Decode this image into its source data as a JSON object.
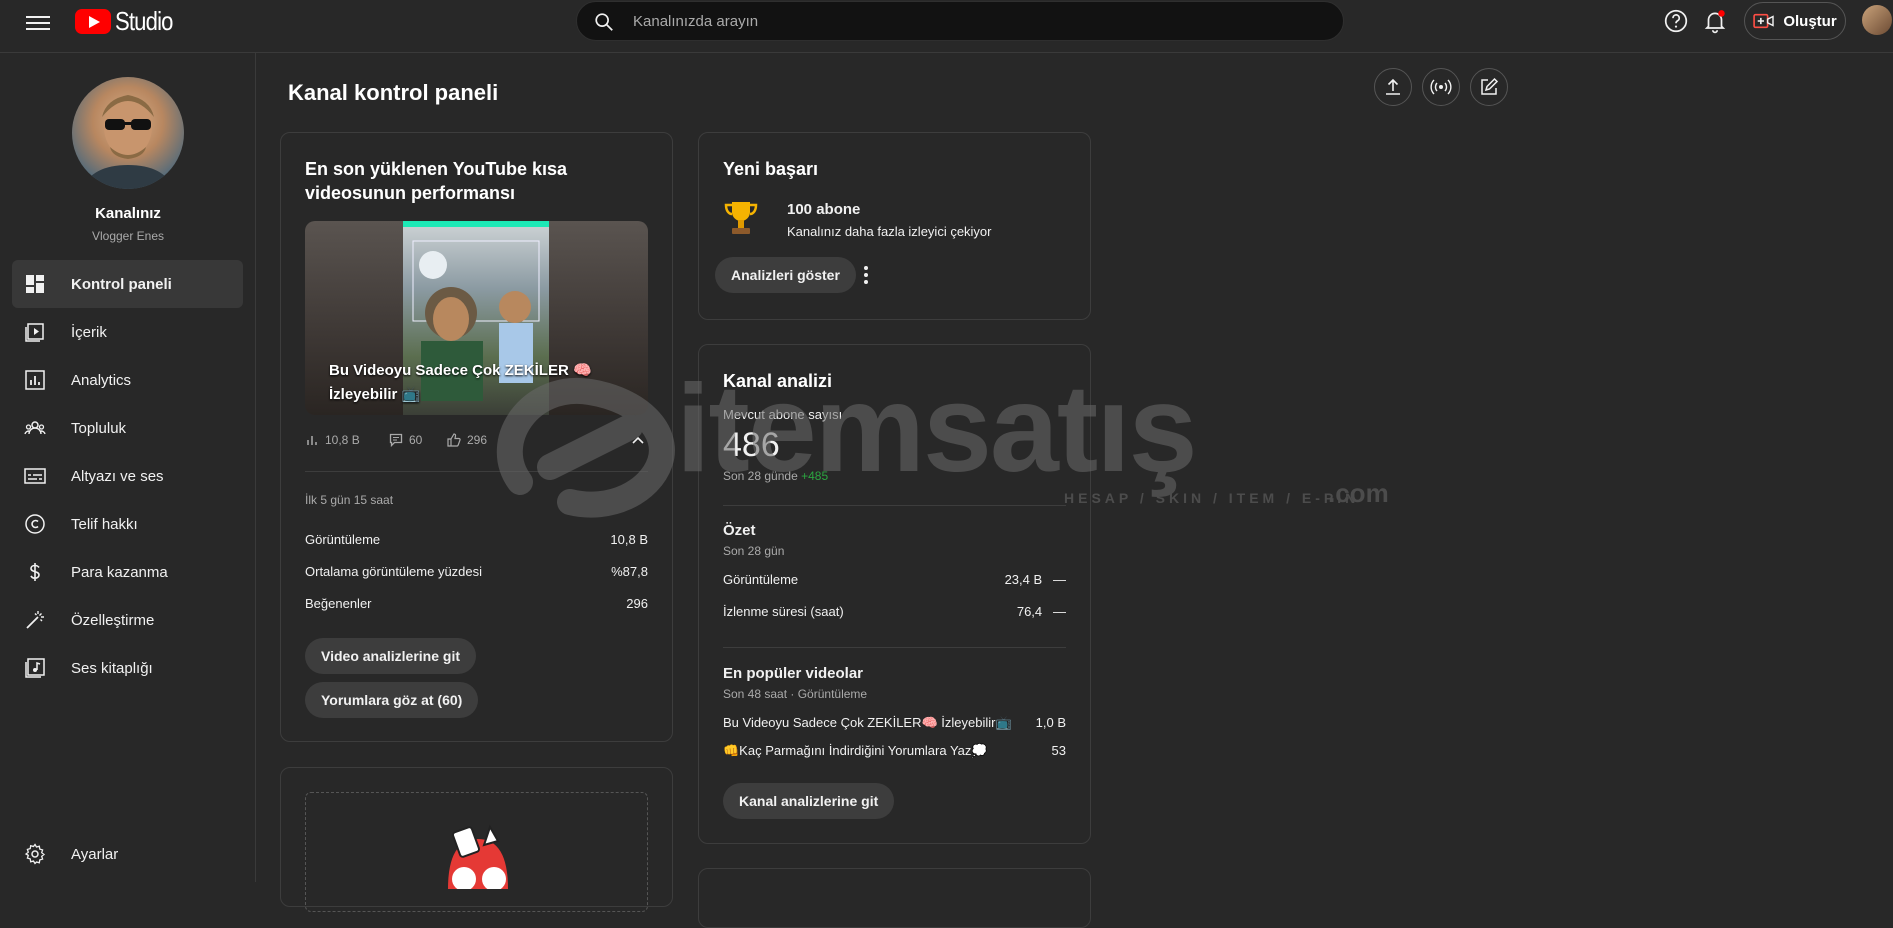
{
  "app": {
    "logo_text": "Studio"
  },
  "search": {
    "placeholder": "Kanalınızda arayın"
  },
  "topbar": {
    "create_label": "Oluştur"
  },
  "sidebar": {
    "channel_name": "Kanalınız",
    "channel_handle": "Vlogger Enes",
    "items": [
      {
        "label": "Kontrol paneli",
        "icon": "dashboard-icon",
        "active": true
      },
      {
        "label": "İçerik",
        "icon": "content-icon"
      },
      {
        "label": "Analytics",
        "icon": "analytics-icon"
      },
      {
        "label": "Topluluk",
        "icon": "community-icon"
      },
      {
        "label": "Altyazı ve ses",
        "icon": "subtitles-icon"
      },
      {
        "label": "Telif hakkı",
        "icon": "copyright-icon"
      },
      {
        "label": "Para kazanma",
        "icon": "dollar-icon"
      },
      {
        "label": "Özelleştirme",
        "icon": "magic-wand-icon"
      },
      {
        "label": "Ses kitaplığı",
        "icon": "audio-library-icon"
      }
    ],
    "settings_label": "Ayarlar"
  },
  "main": {
    "title": "Kanal kontrol paneli"
  },
  "short_card": {
    "title": "En son yüklenen YouTube kısa videosunun performansı",
    "thumb_caption": "Bu Videoyu Sadece Çok ZEKİLER 🧠 İzleyebilir 📺",
    "stats": {
      "views": "10,8 B",
      "comments": "60",
      "likes": "296"
    },
    "period": "İlk 5 gün 15 saat",
    "rows": [
      {
        "label": "Görüntüleme",
        "value": "10,8 B"
      },
      {
        "label": "Ortalama görüntüleme yüzdesi",
        "value": "%87,8"
      },
      {
        "label": "Beğenenler",
        "value": "296"
      }
    ],
    "btn_video": "Video analizlerine git",
    "btn_comments": "Yorumlara göz at (60)"
  },
  "achievement_card": {
    "title": "Yeni başarı",
    "headline": "100 abone",
    "subline": "Kanalınız daha fazla izleyici çekiyor",
    "btn": "Analizleri göster"
  },
  "analytics_card": {
    "title": "Kanal analizi",
    "subs_label": "Mevcut abone sayısı",
    "subs_value": "486",
    "subs_period": "Son 28 günde",
    "subs_delta": "+485",
    "summary_title": "Özet",
    "summary_period": "Son 28 gün",
    "summary_rows": [
      {
        "label": "Görüntüleme",
        "value": "23,4 B",
        "trend": "—"
      },
      {
        "label": "İzlenme süresi (saat)",
        "value": "76,4",
        "trend": "—"
      }
    ],
    "top_title": "En popüler videolar",
    "top_period": "Son 48 saat · Görüntüleme",
    "top_rows": [
      {
        "label": "Bu Videoyu Sadece Çok ZEKİLER🧠 İzleyebilir📺",
        "value": "1,0 B"
      },
      {
        "label": "👊Kaç Parmağını İndirdiğini Yorumlara Yaz💭",
        "value": "53"
      }
    ],
    "btn": "Kanal analizlerine git"
  },
  "watermark": {
    "text": "itemsatış",
    "sub": "HESAP / SKIN / ITEM / E-PIN",
    "dotcom": ".com"
  }
}
